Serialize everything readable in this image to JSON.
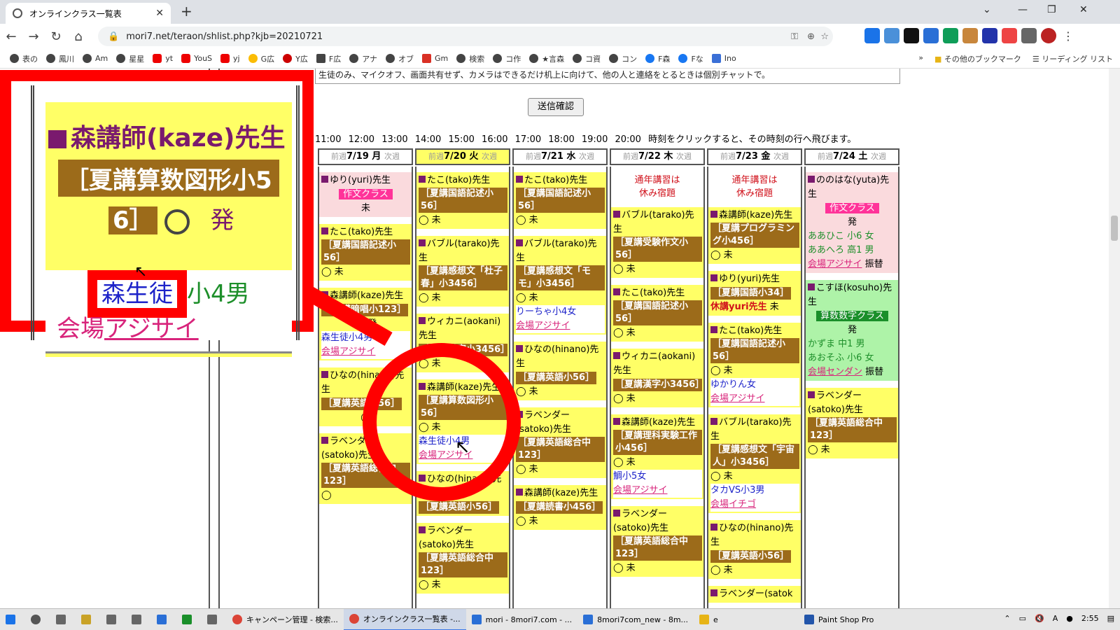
{
  "browser": {
    "tab_title": "オンラインクラス一覧表",
    "tab_close": "✕",
    "new_tab": "+",
    "url": "mori7.net/teraon/shlist.php?kjb=20210721",
    "bookmarks": [
      "表の",
      "鳳川",
      "Am",
      "星星",
      "yt",
      "YouS",
      "yj",
      "G広",
      "Y広",
      "F広",
      "アナ",
      "オブ",
      "Gm",
      "検索",
      "コ作",
      "★言森",
      "コ資",
      "コン",
      "F森",
      "Fな",
      "Ino"
    ],
    "bookmark_other": "その他のブックマーク",
    "bookmark_reading": "リーディング リスト",
    "bm_more": "»"
  },
  "page": {
    "notice": "生徒のみ、マイクオフ、画面共有せず、カメラはできるだけ机上に向けて、他の人と連絡をとるときは個別チャットで。",
    "send_button": "送信確認",
    "times": [
      "11:00",
      "12:00",
      "13:00",
      "14:00",
      "15:00",
      "16:00",
      "17:00",
      "18:00",
      "19:00",
      "20:00"
    ],
    "time_hint": "時刻をクリックすると、その時刻の行へ飛びます。",
    "prev": "前週",
    "next": "次週",
    "days": [
      {
        "label": "7/19 月",
        "highlight": false
      },
      {
        "label": "7/20 火",
        "highlight": true
      },
      {
        "label": "7/21 水",
        "highlight": false
      },
      {
        "label": "7/22 木",
        "highlight": false
      },
      {
        "label": "7/23 金",
        "highlight": false
      },
      {
        "label": "7/24 土",
        "highlight": false
      }
    ]
  },
  "cols": {
    "c0": {
      "a_t": "ゆり(yuri)先生",
      "a_c": "作文クラス",
      "a_s": "未",
      "b_t": "たこ(tako)先生",
      "b_c": "［夏講国語記述小56］",
      "b_s": "◯ 未",
      "c_t": "森講師(kaze)先生",
      "c_c": "［夏講暗唱小123］",
      "c_s": "◯ 発",
      "c_st": "森生徒小4男",
      "c_v": "会場アジサイ",
      "d_t": "ひなの(hinano)先生",
      "d_c": "［夏講英語小56］",
      "d_s": "◯",
      "e_t": "ラベンダー(satoko)先生",
      "e_c": "［夏講英語総合中123］",
      "e_s": "◯"
    },
    "c1": {
      "a_t": "たこ(tako)先生",
      "a_c": "［夏講国語記述小56］",
      "a_s": "◯ 未",
      "b_t": "バブル(tarako)先生",
      "b_c": "［夏講感想文「杜子春」小3456］",
      "b_s": "◯ 未",
      "c_t": "ウィカニ(aokani)先生",
      "c_c": "［夏講漢字小3456］",
      "c_s": "◯ 未",
      "d_t": "森講師(kaze)先生",
      "d_c": "［夏講算数図形小56］",
      "d_s": "◯ 未",
      "d_st": "森生徒小4男",
      "d_v": "会場アジサイ",
      "e_t": "ひなの(hinano)先生",
      "e_c": "［夏講英語小56］",
      "f_t": "ラベンダー(satoko)先生",
      "f_c": "［夏講英語総合中123］",
      "f_s": "◯ 未"
    },
    "c2": {
      "a_t": "たこ(tako)先生",
      "a_c": "［夏講国語記述小56］",
      "a_s": "◯ 未",
      "b_t": "バブル(tarako)先生",
      "b_c": "［夏講感想文「モモ」小3456］",
      "b_s": "◯ 未",
      "b_st": "りーちゃ小4女",
      "b_v": "会場アジサイ",
      "c_t": "ひなの(hinano)先生",
      "c_c": "［夏講英語小56］",
      "c_s": "◯ 未",
      "d_t": "ラベンダー(satoko)先生",
      "d_c": "［夏講英語総合中123］",
      "d_s": "◯ 未",
      "e_t": "森講師(kaze)先生",
      "e_c": "［夏講読書小456］",
      "e_s": "◯ 未"
    },
    "c3": {
      "note": "通年講習は\n休み宿題",
      "a_t": "バブル(tarako)先生",
      "a_c": "［夏講受験作文小56］",
      "a_s": "◯ 未",
      "b_t": "たこ(tako)先生",
      "b_c": "［夏講国語記述小56］",
      "b_s": "◯ 未",
      "c_t": "ウィカニ(aokani)先生",
      "c_c": "［夏講漢字小3456］",
      "c_s": "◯ 未",
      "d_t": "森講師(kaze)先生",
      "d_c": "［夏講理科実験工作小456］",
      "d_s": "◯ 未",
      "d_st": "鯛小5女",
      "d_v": "会場アジサイ",
      "e_t": "ラベンダー(satoko)先生",
      "e_c": "［夏講英語総合中123］",
      "e_s": "◯ 未"
    },
    "c4": {
      "note": "通年講習は\n休み宿題",
      "a_t": "森講師(kaze)先生",
      "a_c": "［夏講プログラミング小456］",
      "a_s": "◯ 未",
      "b_t": "ゆり(yuri)先生",
      "b_c": "［夏講国語小34］",
      "b_x": "休講yuri先生",
      "b_s": "未",
      "c_t": "たこ(tako)先生",
      "c_c": "［夏講国語記述小56］",
      "c_s": "◯ 未",
      "c_st": "ゆかりん女",
      "c_v": "会場アジサイ",
      "d_t": "バブル(tarako)先生",
      "d_c": "［夏講感想文「宇宙人」小3456］",
      "d_s": "◯ 未",
      "d_st": "タカVS小3男",
      "d_v": "会場イチゴ",
      "e_t": "ひなの(hinano)先生",
      "e_c": "［夏講英語小56］",
      "e_s": "◯ 未",
      "f_t": "ラベンダー(satok"
    },
    "c5": {
      "a_t": "ののはな(yuta)先生",
      "a_c": "作文クラス",
      "a_s": "発",
      "a_s1": "ああひこ 小6 女",
      "a_s2": "ああへろ 高1 男",
      "a_v": "会場アジサイ",
      "a_f": "振替",
      "b_t": "こすほ(kosuho)先生",
      "b_c": "算数数字クラス",
      "b_s": "発",
      "b_s1": "かずま 中1 男",
      "b_s2": "あおそふ 小6 女",
      "b_v": "会場センダン",
      "b_f": "振替",
      "c_t": "ラベンダー(satoko)先生",
      "c_c": "［夏講英語総合中123］",
      "c_s": "◯ 未"
    }
  },
  "zoom": {
    "teacher": "森講師(kaze)先生",
    "course": "［夏講算数図形小5",
    "course2": "6］",
    "status": "発",
    "student": "森生徒",
    "student_rest": "小4男",
    "venue_pre": "会場",
    "venue_name": "アジサイ"
  },
  "taskbar": {
    "items": [
      "キャンペーン管理 - 検索...",
      "オンラインクラス一覧表 -...",
      "mori - 8mori7.com - ...",
      "8mori7com_new - 8m...",
      "e",
      "Paint Shop Pro"
    ],
    "clock": "2:55"
  },
  "colors": {
    "accent_red": "#ff0000",
    "cell_yellow": "#ffff66",
    "course_brown": "#9c6b1a"
  }
}
